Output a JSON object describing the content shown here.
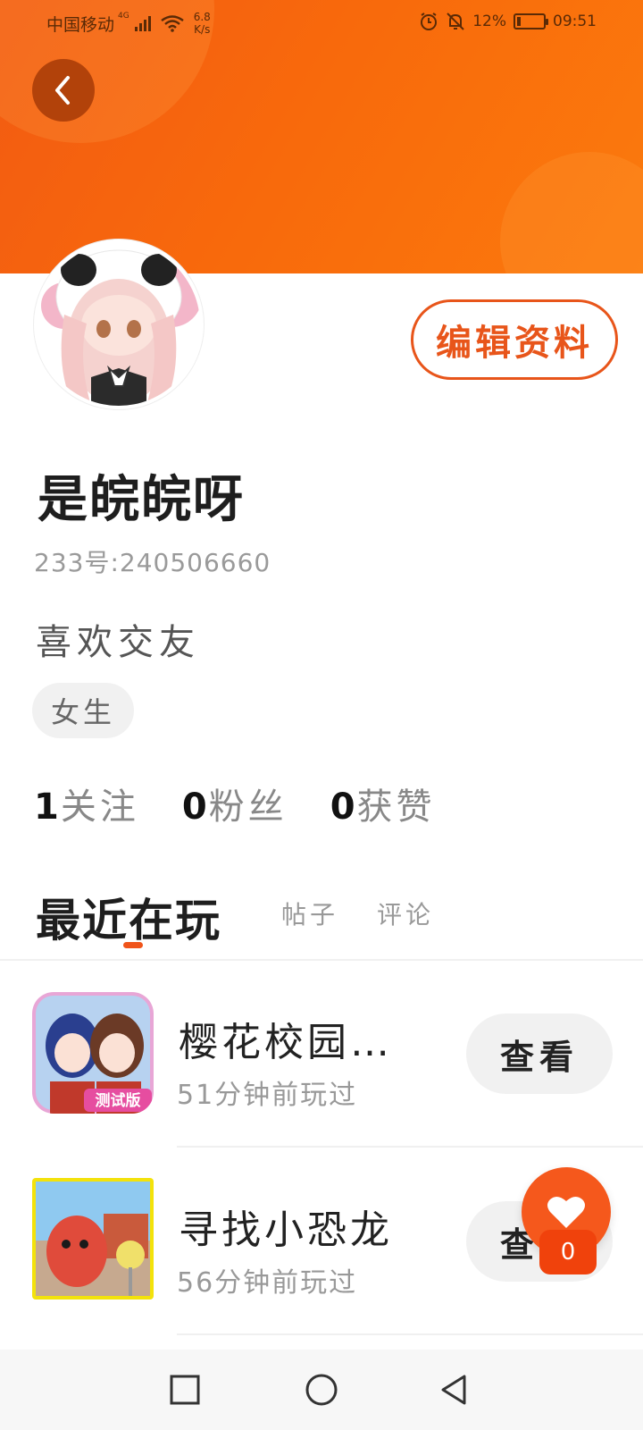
{
  "status_bar": {
    "carrier": "中国移动",
    "network": "4G",
    "speed_value": "6.8",
    "speed_unit": "K/s",
    "battery": "12%",
    "time": "09:51",
    "icons": [
      "signal-icon",
      "wifi-icon",
      "alarm-icon",
      "mute-icon",
      "battery-icon"
    ]
  },
  "header": {
    "back_icon": "chevron-left-icon",
    "banner_color": "#f8690c"
  },
  "profile": {
    "edit_label": "编辑资料",
    "username": "是皖皖呀",
    "user_id": "233号:240506660",
    "bio": "喜欢交友",
    "gender": "女生",
    "stats": [
      {
        "num": "1",
        "label": "关注"
      },
      {
        "num": "0",
        "label": "粉丝"
      },
      {
        "num": "0",
        "label": "获赞"
      }
    ]
  },
  "tabs": [
    {
      "label": "最近在玩",
      "active": true
    },
    {
      "label": "帖子",
      "active": false
    },
    {
      "label": "评论",
      "active": false
    }
  ],
  "games": [
    {
      "name": "樱花校园…",
      "time": "51分钟前玩过",
      "action": "查看",
      "icon_badge": "测试版"
    },
    {
      "name": "寻找小恐龙",
      "time": "56分钟前玩过",
      "action": "查看"
    }
  ],
  "like_fab": {
    "icon": "heart-icon",
    "count": "0"
  },
  "nav_bar": {
    "icons": [
      "recent-apps-icon",
      "home-icon",
      "back-icon"
    ]
  },
  "colors": {
    "accent": "#f0541a",
    "text": "#222222",
    "muted": "#999999"
  }
}
